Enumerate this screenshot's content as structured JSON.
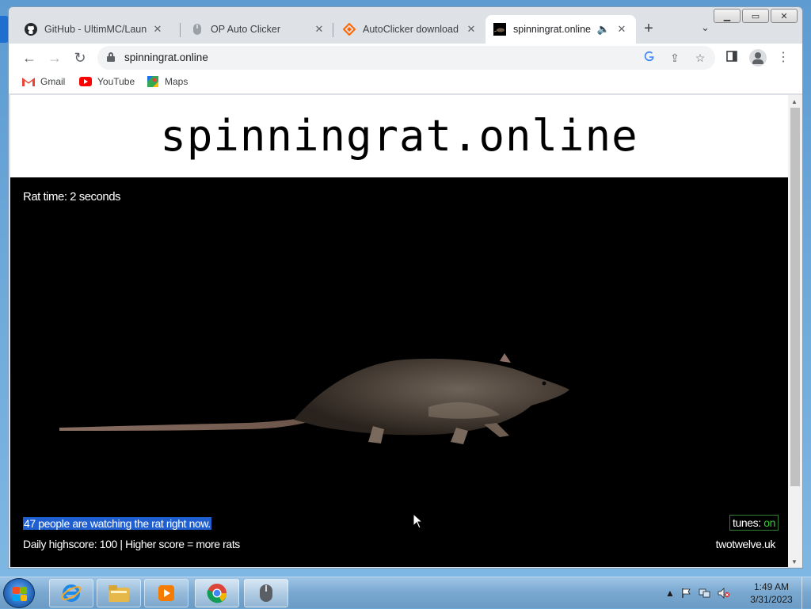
{
  "browser": {
    "tabs": [
      {
        "label": "GitHub - UltimMC/Launcher",
        "icon": "github-icon"
      },
      {
        "label": "OP Auto Clicker",
        "icon": "mouse-icon"
      },
      {
        "label": "AutoClicker download | SourceForge.net",
        "icon": "sourceforge-icon"
      },
      {
        "label": "spinningrat.online",
        "icon": "site-favicon",
        "active": true,
        "audio": true
      }
    ],
    "url": "spinningrat.online",
    "bookmarks": [
      {
        "label": "Gmail",
        "icon": "gmail-icon"
      },
      {
        "label": "YouTube",
        "icon": "youtube-icon"
      },
      {
        "label": "Maps",
        "icon": "maps-icon"
      }
    ],
    "window_controls": {
      "minimize": "▁",
      "maximize": "▭",
      "close": "✕"
    }
  },
  "page": {
    "site_title": "spinningrat.online",
    "rat_time": "Rat time: 2 seconds",
    "watching": "47 people are watching the rat right now.",
    "highscore": "Daily highscore: 100 | Higher score = more rats",
    "tunes_label": "tunes:",
    "tunes_state": "on",
    "credit": "twotwelve.uk"
  },
  "taskbar": {
    "time": "1:49 AM",
    "date": "3/31/2023"
  },
  "colors": {
    "selection": "#1f5fd0",
    "tunes_on": "#29d02f",
    "stage": "#000000"
  }
}
